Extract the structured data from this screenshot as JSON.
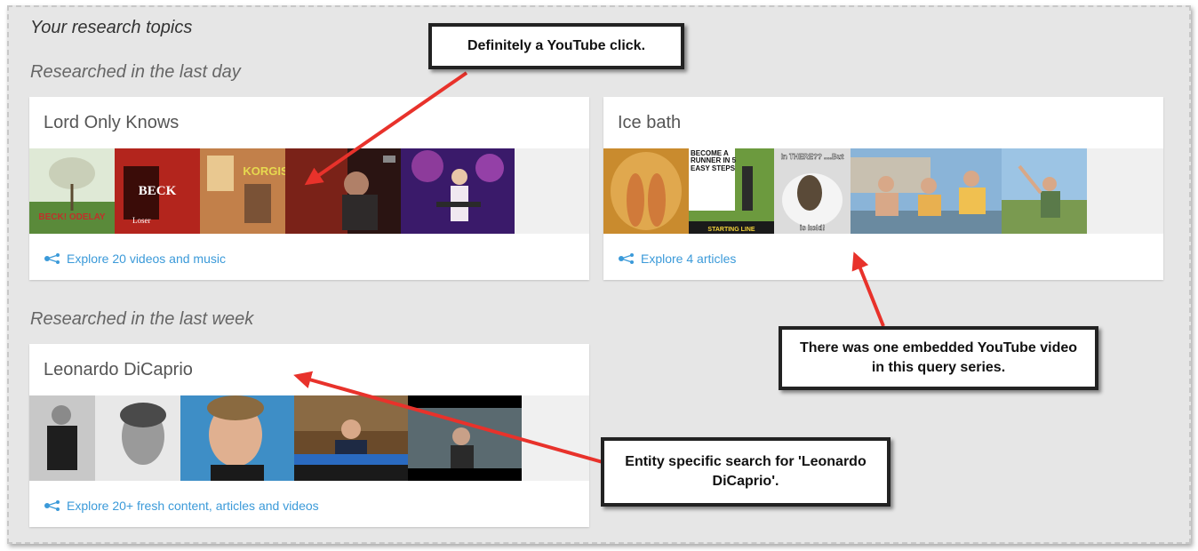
{
  "page": {
    "heading": "Your research topics"
  },
  "sections": {
    "last_day": "Researched in the last day",
    "last_week": "Researched in the last week"
  },
  "cards": {
    "lord_only_knows": {
      "title": "Lord Only Knows",
      "explore": "Explore 20 videos and music",
      "thumb_text": {
        "album": "BECK! ODELAY",
        "beck": "BECK",
        "loser": "Loser",
        "korgis": "KORGIS"
      }
    },
    "ice_bath": {
      "title": "Ice bath",
      "explore": "Explore 4 articles",
      "thumb_text": {
        "runner": "BECOME A RUNNER IN 5 EASY STEPS",
        "starting": "STARTING LINE",
        "otter_top": "In THERE?? ....But",
        "otter_bottom": "is kold!"
      }
    },
    "leonardo": {
      "title": "Leonardo DiCaprio",
      "explore": "Explore 20+ fresh content, articles and videos"
    }
  },
  "callouts": {
    "youtube_click": "Definitely a YouTube click.",
    "embedded": "There was one embedded YouTube video in this query series.",
    "entity": "Entity specific search for 'Leonardo DiCaprio'."
  },
  "colors": {
    "link": "#3b9ad9",
    "arrow": "#e8322b",
    "background": "#e6e6e6"
  },
  "icons": {
    "explore": "share-nodes-icon"
  }
}
